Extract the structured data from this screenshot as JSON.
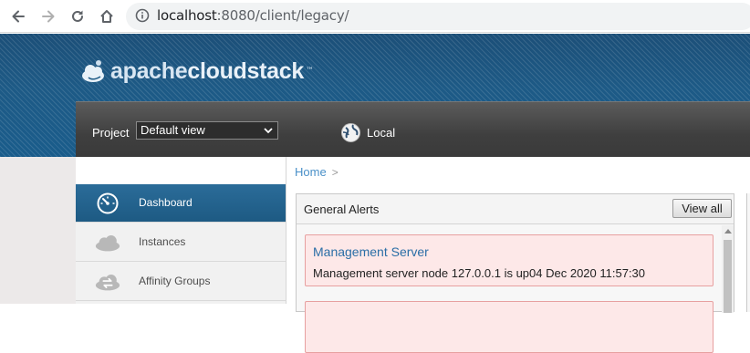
{
  "browser": {
    "url_host": "localhost",
    "url_rest": ":8080/client/legacy/",
    "icons": [
      "back-icon",
      "forward-icon",
      "reload-icon",
      "home-icon",
      "info-icon"
    ]
  },
  "header": {
    "logo_part1": "apache",
    "logo_part2": "cloudstack",
    "logo_tm": "™",
    "project_label": "Project",
    "project_selected": "Default view",
    "zone_label": "Local"
  },
  "sidebar": {
    "items": [
      {
        "label": "Dashboard",
        "icon": "dashboard-gauge-icon",
        "active": true
      },
      {
        "label": "Instances",
        "icon": "cloud-icon",
        "active": false
      },
      {
        "label": "Affinity Groups",
        "icon": "affinity-cloud-arrows-icon",
        "active": false
      }
    ]
  },
  "main": {
    "breadcrumb_home": "Home",
    "breadcrumb_sep": ">",
    "panel_title": "General Alerts",
    "view_all_label": "View all",
    "alerts": [
      {
        "title": "Management Server",
        "description": "Management server node 127.0.0.1 is up04 Dec 2020 11:57:30"
      },
      {
        "title": "",
        "description": ""
      }
    ]
  },
  "colors": {
    "header_blue": "#1d5a86",
    "toolbar_dark": "#3f3f3f",
    "active_item": "#1d5a83",
    "alert_bg": "#fde8e8",
    "alert_border": "#e7a0a0",
    "link_blue": "#4a90c8"
  }
}
